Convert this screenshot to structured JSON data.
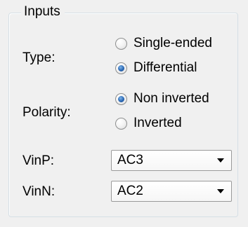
{
  "group": {
    "title": "Inputs"
  },
  "type": {
    "label": "Type:",
    "options": [
      {
        "label": "Single-ended",
        "checked": false
      },
      {
        "label": "Differential",
        "checked": true
      }
    ]
  },
  "polarity": {
    "label": "Polarity:",
    "options": [
      {
        "label": "Non inverted",
        "checked": true
      },
      {
        "label": "Inverted",
        "checked": false
      }
    ]
  },
  "vinp": {
    "label": "VinP:",
    "value": "AC3"
  },
  "vinn": {
    "label": "VinN:",
    "value": "AC2"
  }
}
